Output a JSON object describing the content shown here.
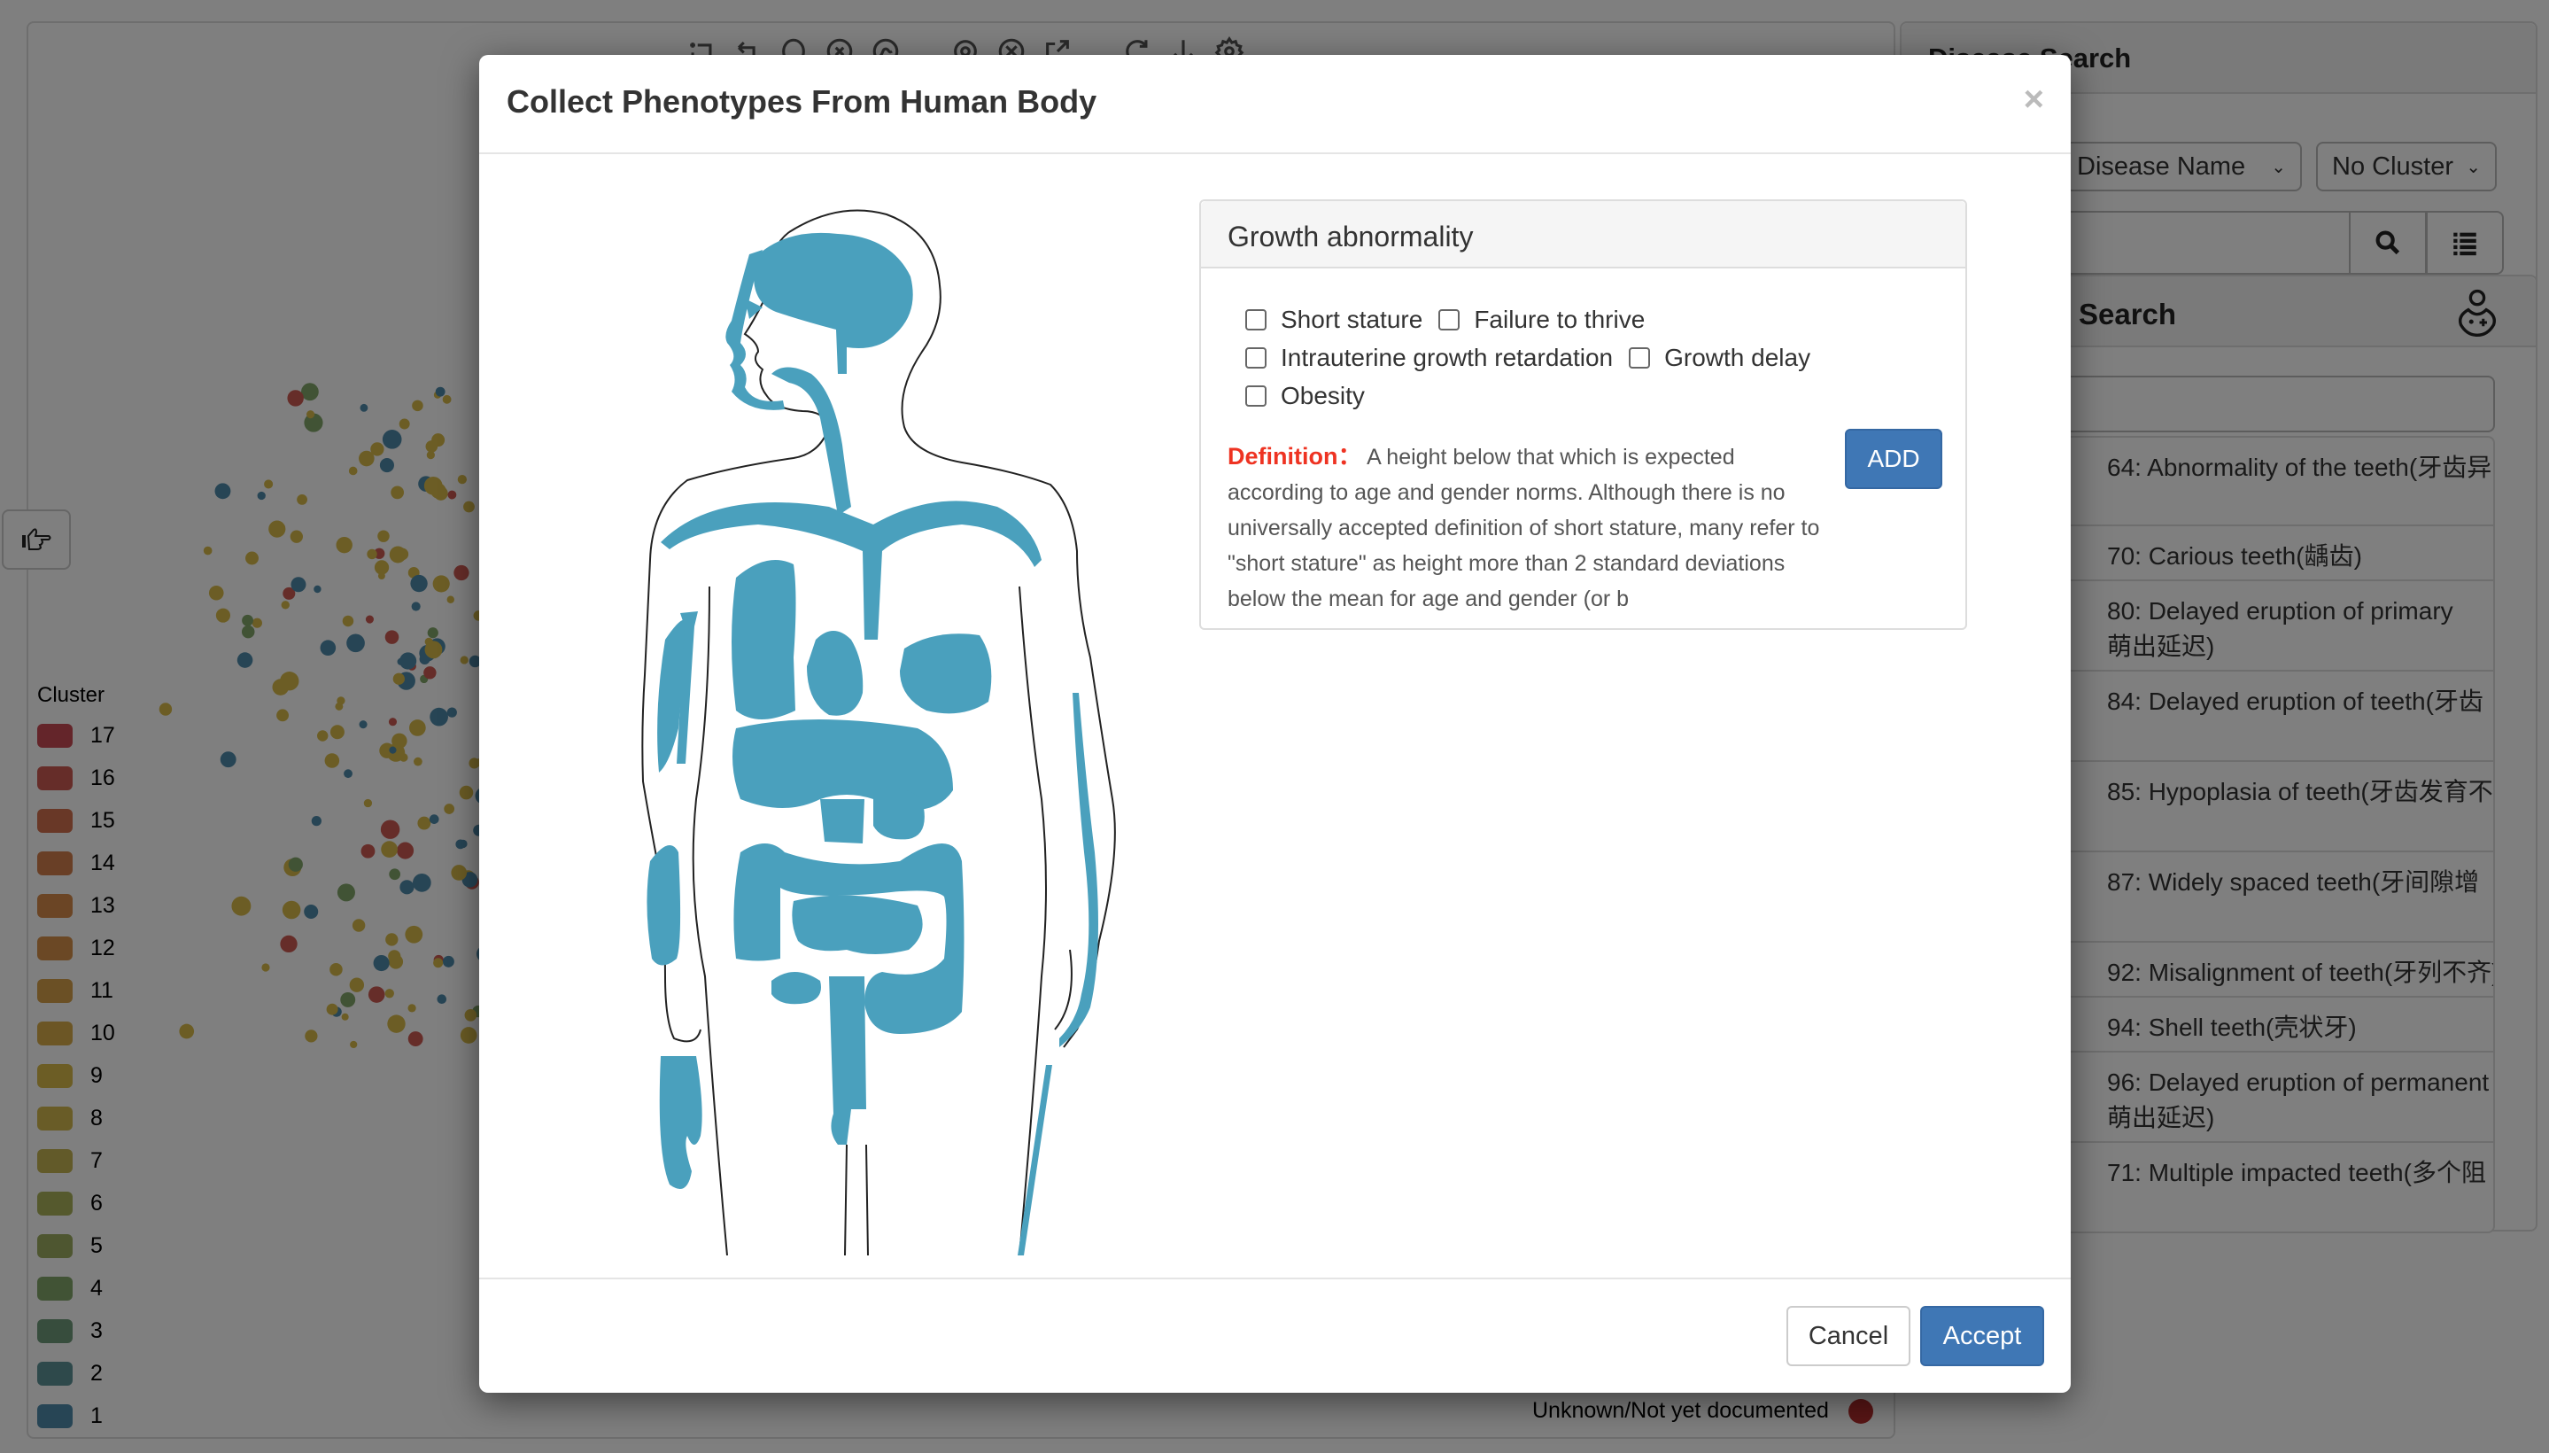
{
  "background": {
    "toolbar": {
      "icons": [
        "rect-zoom-icon",
        "zoom-back-icon",
        "lasso-icon",
        "clear-selection-icon",
        "link-icon",
        "target-icon",
        "close-circle-icon",
        "export-icon",
        "refresh-icon",
        "download-icon",
        "settings-icon"
      ]
    },
    "legend": {
      "title": "Cluster",
      "items": [
        {
          "label": "17",
          "color": "#c94b55"
        },
        {
          "label": "16",
          "color": "#cd5b52"
        },
        {
          "label": "15",
          "color": "#d3704f"
        },
        {
          "label": "14",
          "color": "#d37f4c"
        },
        {
          "label": "13",
          "color": "#d68b4a"
        },
        {
          "label": "12",
          "color": "#d6914a"
        },
        {
          "label": "11",
          "color": "#d6a04a"
        },
        {
          "label": "10",
          "color": "#d8ad4b"
        },
        {
          "label": "9",
          "color": "#d8bb4b"
        },
        {
          "label": "8",
          "color": "#d2b84e"
        },
        {
          "label": "7",
          "color": "#c4b553"
        },
        {
          "label": "6",
          "color": "#aab35a"
        },
        {
          "label": "5",
          "color": "#9cad60"
        },
        {
          "label": "4",
          "color": "#82a66a"
        },
        {
          "label": "3",
          "color": "#6f9a7a"
        },
        {
          "label": "2",
          "color": "#5d9297"
        },
        {
          "label": "1",
          "color": "#4f8aab"
        }
      ]
    },
    "unknown_legend": {
      "label": "Unknown/Not yet documented",
      "color": "#b52c2c"
    },
    "disease_search": {
      "title": "Disease Search",
      "search_by": "Disease Name",
      "cluster": "No Cluster",
      "search_placeholder": "..."
    },
    "phenotype_search": {
      "title": "Search",
      "results": [
        "64: Abnormality of the teeth(牙齿异",
        "70: Carious teeth(龋齿)",
        "80: Delayed eruption of primary\n萌出延迟)",
        "84: Delayed eruption of teeth(牙齿",
        "85: Hypoplasia of teeth(牙齿发育不",
        "87: Widely spaced teeth(牙间隙增",
        "92: Misalignment of teeth(牙列不齐)",
        "94: Shell teeth(壳状牙)",
        "96: Delayed eruption of permanent\n萌出延迟)",
        "71: Multiple impacted teeth(多个阻"
      ]
    }
  },
  "modal": {
    "title": "Collect Phenotypes From Human Body",
    "close_label": "×",
    "diagram_color": "#4aa0bd",
    "category": {
      "title": "Growth abnormality",
      "options": [
        {
          "label": "Short stature",
          "checked": false
        },
        {
          "label": "Failure to thrive",
          "checked": false
        },
        {
          "label": "Intrauterine growth retardation",
          "checked": false
        },
        {
          "label": "Growth delay",
          "checked": false
        },
        {
          "label": "Obesity",
          "checked": false
        }
      ],
      "definition_label": "Definition：",
      "definition_text": "A height below that which is expected according to age and gender norms. Although there is no universally accepted definition of short stature, many refer to \"short stature\" as height more than 2 standard deviations below the mean for age and gender (or b",
      "add_label": "ADD"
    },
    "footer": {
      "cancel_label": "Cancel",
      "accept_label": "Accept"
    }
  }
}
